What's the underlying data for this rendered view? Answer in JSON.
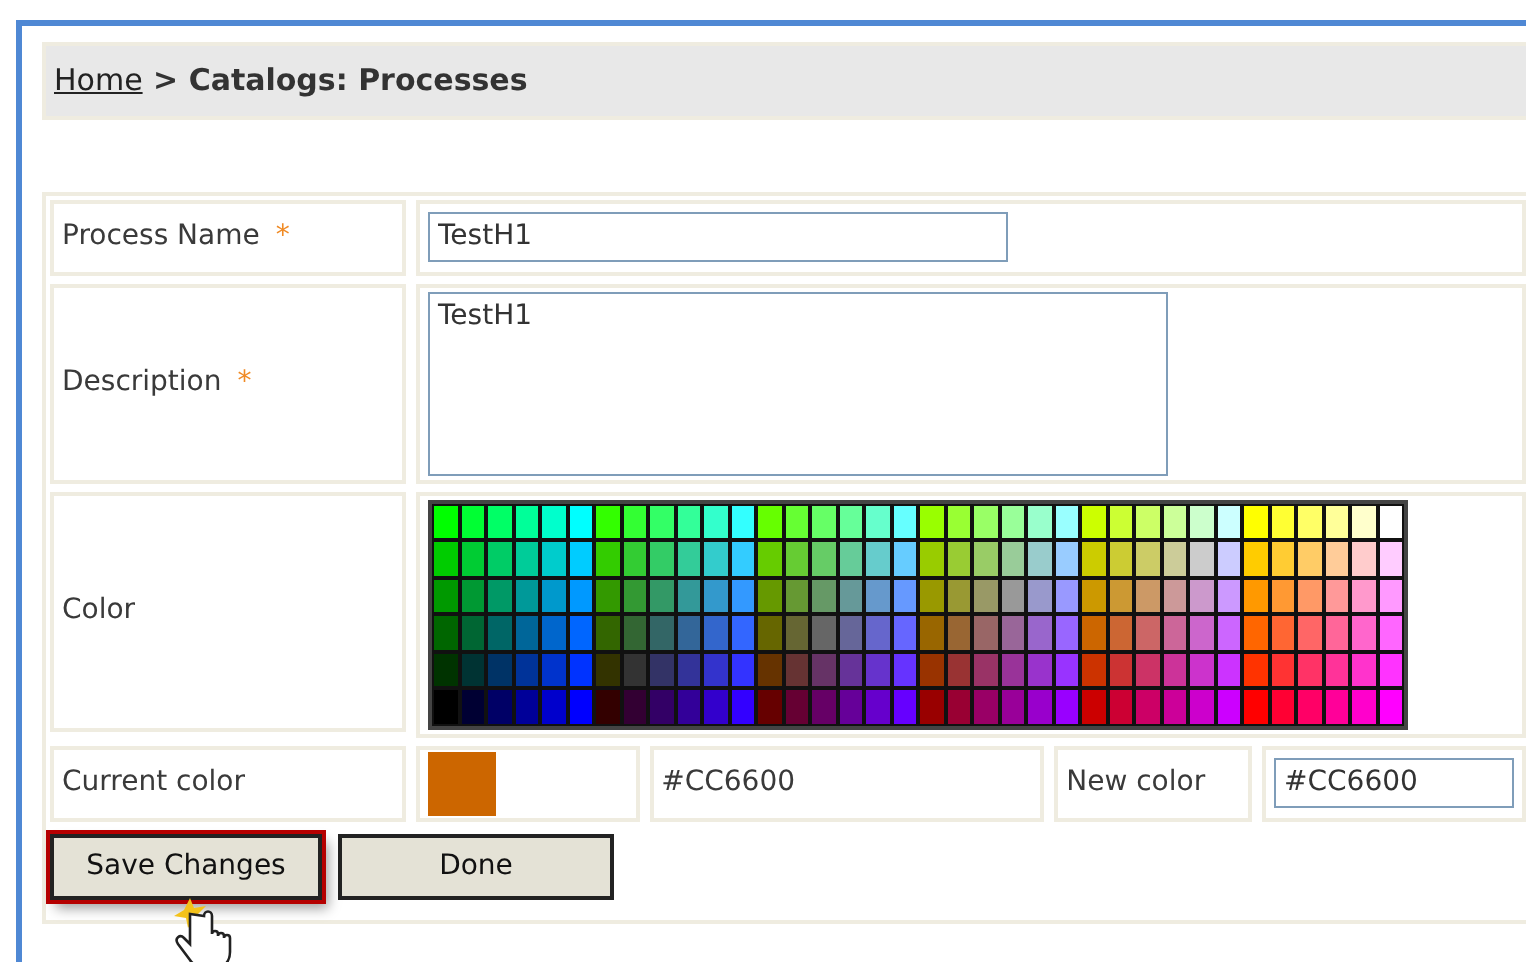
{
  "breadcrumb": {
    "home_link": "Home",
    "separator": ">",
    "current": "Catalogs: Processes"
  },
  "fields": [
    {
      "kind": "text",
      "label": "Process Name",
      "required_mark": "*",
      "value": "TestH1"
    },
    {
      "kind": "textarea",
      "label": "Description",
      "required_mark": "*",
      "value": "TestH1"
    },
    {
      "kind": "palette",
      "label": "Color"
    }
  ],
  "current_color": {
    "label": "Current color",
    "color": "#cc6600",
    "value": "#CC6600"
  },
  "new_color": {
    "label": "New color",
    "value": "#CC6600"
  },
  "buttons": [
    {
      "label": "Save Changes",
      "highlighted": true
    },
    {
      "label": "Done",
      "highlighted": false
    }
  ]
}
